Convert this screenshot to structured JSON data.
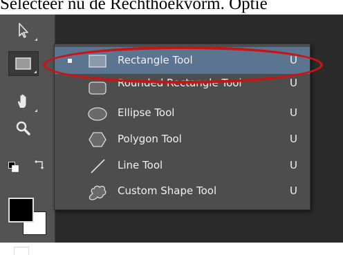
{
  "caption": "Selecteer nu de Rechthoekvorm. Optie",
  "tool_menu": {
    "items": [
      {
        "label": "Rectangle Tool",
        "shortcut": "U",
        "icon": "rectangle-icon",
        "selected": true
      },
      {
        "label": "Rounded Rectangle Tool",
        "shortcut": "U",
        "icon": "rounded-rectangle-icon",
        "selected": false
      },
      {
        "label": "Ellipse Tool",
        "shortcut": "U",
        "icon": "ellipse-icon",
        "selected": false
      },
      {
        "label": "Polygon Tool",
        "shortcut": "U",
        "icon": "polygon-icon",
        "selected": false
      },
      {
        "label": "Line Tool",
        "shortcut": "U",
        "icon": "line-icon",
        "selected": false
      },
      {
        "label": "Custom Shape Tool",
        "shortcut": "U",
        "icon": "custom-shape-icon",
        "selected": false
      }
    ]
  },
  "toolbar": {
    "tools": [
      "path-selection-icon",
      "rectangle-tool-icon",
      "hand-icon",
      "zoom-icon",
      "default-colors-icon",
      "swap-colors-icon"
    ],
    "foreground_color": "#000000",
    "background_color": "#ffffff"
  },
  "colors": {
    "panel": "#535353",
    "menu": "#4d4d4d",
    "selected": "#5b7591",
    "annotation": "#c91414"
  }
}
